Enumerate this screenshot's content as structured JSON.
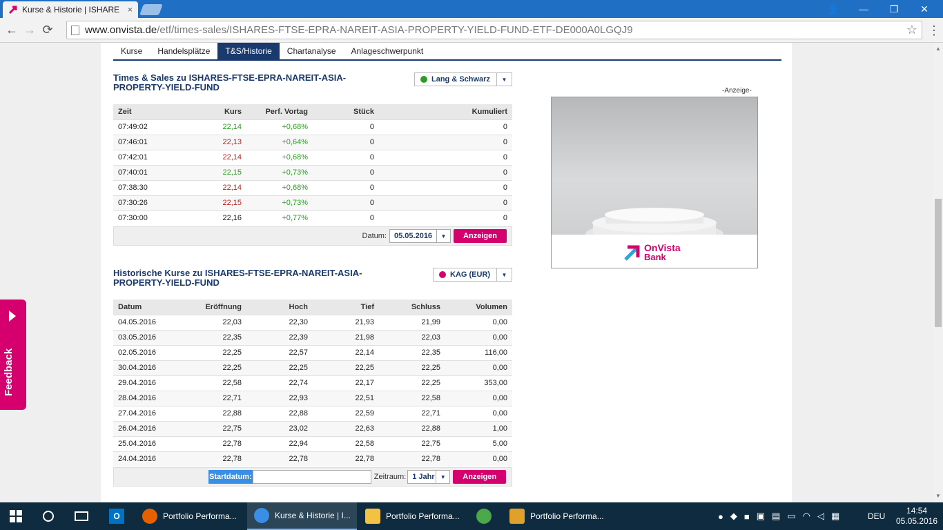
{
  "browser": {
    "tab_title": "Kurse & Historie | ISHARE",
    "tab_close": "×",
    "url_host": "www.onvista.de",
    "url_path": "/etf/times-sales/ISHARES-FTSE-EPRA-NAREIT-ASIA-PROPERTY-YIELD-FUND-ETF-DE000A0LGQJ9",
    "back": "←",
    "forward": "→",
    "reload": "⟳",
    "star": "☆",
    "menu": "⋮",
    "win_user": "👤",
    "win_min": "—",
    "win_max": "❐",
    "win_close": "✕"
  },
  "subnav": [
    "Kurse",
    "Handelsplätze",
    "T&S/Historie",
    "Chartanalyse",
    "Anlageschwerpunkt"
  ],
  "ts": {
    "title": "Times & Sales zu ISHARES-FTSE-EPRA-NAREIT-ASIA-PROPERTY-YIELD-FUND",
    "exchange": "Lang & Schwarz",
    "exchange_color": "#2a9d22",
    "columns": [
      "Zeit",
      "Kurs",
      "Perf. Vortag",
      "Stück",
      "Kumuliert"
    ],
    "rows": [
      [
        "07:49:02",
        "22,14",
        "+0,68%",
        "0",
        "0",
        "up"
      ],
      [
        "07:46:01",
        "22,13",
        "+0,64%",
        "0",
        "0",
        "dn"
      ],
      [
        "07:42:01",
        "22,14",
        "+0,68%",
        "0",
        "0",
        "dn"
      ],
      [
        "07:40:01",
        "22,15",
        "+0,73%",
        "0",
        "0",
        "up"
      ],
      [
        "07:38:30",
        "22,14",
        "+0,68%",
        "0",
        "0",
        "dn"
      ],
      [
        "07:30:26",
        "22,15",
        "+0,73%",
        "0",
        "0",
        "dn"
      ],
      [
        "07:30:00",
        "22,16",
        "+0,77%",
        "0",
        "0",
        "neutral"
      ]
    ],
    "datum_label": "Datum:",
    "datum_value": "05.05.2016",
    "button": "Anzeigen"
  },
  "hist": {
    "title": "Historische Kurse zu ISHARES-FTSE-EPRA-NAREIT-ASIA-PROPERTY-YIELD-FUND",
    "exchange": "KAG (EUR)",
    "exchange_color": "#d5006d",
    "columns": [
      "Datum",
      "Eröffnung",
      "Hoch",
      "Tief",
      "Schluss",
      "Volumen"
    ],
    "rows": [
      [
        "04.05.2016",
        "22,03",
        "22,30",
        "21,93",
        "21,99",
        "0,00"
      ],
      [
        "03.05.2016",
        "22,35",
        "22,39",
        "21,98",
        "22,03",
        "0,00"
      ],
      [
        "02.05.2016",
        "22,25",
        "22,57",
        "22,14",
        "22,35",
        "116,00"
      ],
      [
        "30.04.2016",
        "22,25",
        "22,25",
        "22,25",
        "22,25",
        "0,00"
      ],
      [
        "29.04.2016",
        "22,58",
        "22,74",
        "22,17",
        "22,25",
        "353,00"
      ],
      [
        "28.04.2016",
        "22,71",
        "22,93",
        "22,51",
        "22,58",
        "0,00"
      ],
      [
        "27.04.2016",
        "22,88",
        "22,88",
        "22,59",
        "22,71",
        "0,00"
      ],
      [
        "26.04.2016",
        "22,75",
        "23,02",
        "22,63",
        "22,88",
        "1,00"
      ],
      [
        "25.04.2016",
        "22,78",
        "22,94",
        "22,58",
        "22,75",
        "5,00"
      ],
      [
        "24.04.2016",
        "22,78",
        "22,78",
        "22,78",
        "22,78",
        "0,00"
      ]
    ],
    "start_label": "Startdatum:",
    "start_value": "",
    "zeitraum_label": "Zeitraum:",
    "zeitraum_value": "1 Jahr",
    "button": "Anzeigen"
  },
  "ad": {
    "label": "-Anzeige-",
    "brand_line1": "OnVista",
    "brand_line2": "Bank"
  },
  "feedback": "Feedback",
  "taskbar": {
    "apps": [
      {
        "label": "Portfolio Performa...",
        "icon": "firefox-icon",
        "color": "#e66000"
      },
      {
        "label": "Kurse & Historie | I...",
        "icon": "chrome-icon",
        "color": "#3a8ee6"
      },
      {
        "label": "Portfolio Performa...",
        "icon": "folder-icon",
        "color": "#f3c242"
      },
      {
        "label": "",
        "icon": "globe-icon",
        "color": "#4aa84a"
      },
      {
        "label": "Portfolio Performa...",
        "icon": "chart-app-icon",
        "color": "#e0a02a"
      }
    ],
    "lang": "DEU",
    "time": "14:54",
    "date": "05.05.2016"
  }
}
